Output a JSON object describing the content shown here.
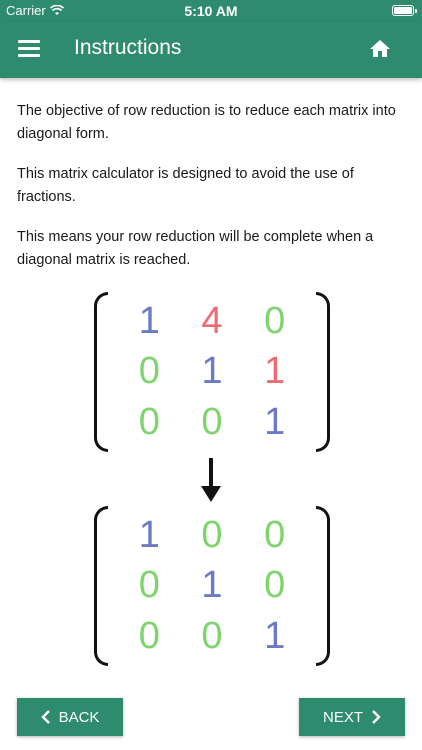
{
  "status_bar": {
    "carrier": "Carrier",
    "time": "5:10 AM",
    "battery_level": 1.0
  },
  "app_bar": {
    "title": "Instructions",
    "menu_icon": "hamburger-menu-icon",
    "home_icon": "home-icon"
  },
  "paragraphs": [
    "The objective of row reduction is to reduce each matrix into diagonal form.",
    "This matrix calculator is designed to avoid the use of fractions.",
    "This means your row reduction will be complete when a diagonal matrix is reached."
  ],
  "colors": {
    "primary": "#2e8b6e",
    "blue": "#6b79c6",
    "green": "#7fd46d",
    "red": "#ef6b72"
  },
  "matrix_before": [
    [
      {
        "v": "1",
        "c": "blue"
      },
      {
        "v": "4",
        "c": "red"
      },
      {
        "v": "0",
        "c": "green"
      }
    ],
    [
      {
        "v": "0",
        "c": "green"
      },
      {
        "v": "1",
        "c": "blue"
      },
      {
        "v": "1",
        "c": "red"
      }
    ],
    [
      {
        "v": "0",
        "c": "green"
      },
      {
        "v": "0",
        "c": "green"
      },
      {
        "v": "1",
        "c": "blue"
      }
    ]
  ],
  "matrix_after": [
    [
      {
        "v": "1",
        "c": "blue"
      },
      {
        "v": "0",
        "c": "green"
      },
      {
        "v": "0",
        "c": "green"
      }
    ],
    [
      {
        "v": "0",
        "c": "green"
      },
      {
        "v": "1",
        "c": "blue"
      },
      {
        "v": "0",
        "c": "green"
      }
    ],
    [
      {
        "v": "0",
        "c": "green"
      },
      {
        "v": "0",
        "c": "green"
      },
      {
        "v": "1",
        "c": "blue"
      }
    ]
  ],
  "arrow_icon": "down-arrow-icon",
  "buttons": {
    "back_label": "BACK",
    "next_label": "NEXT"
  }
}
